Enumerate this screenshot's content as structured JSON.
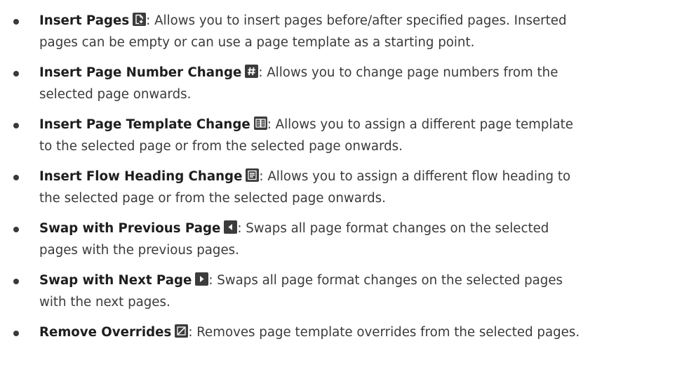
{
  "items": [
    {
      "name": "Insert Pages",
      "icon": "insert-pages-icon",
      "line1": ": Allows you to insert pages before/after specified pages. Inserted",
      "line2": "pages can be empty or can use a page template as a starting point."
    },
    {
      "name": "Insert Page Number Change",
      "icon": "page-number-hash-icon",
      "line1": ": Allows you to change page numbers from the",
      "line2": "selected page onwards."
    },
    {
      "name": "Insert Page Template Change",
      "icon": "page-template-icon",
      "line1": ": Allows you to assign a different page template",
      "line2": "to the selected page or from the selected page onwards."
    },
    {
      "name": "Insert Flow Heading Change",
      "icon": "flow-heading-icon",
      "line1": ": Allows you to assign a different flow heading to",
      "line2": "the selected page or from the selected page onwards."
    },
    {
      "name": "Swap with Previous Page",
      "icon": "previous-arrow-icon",
      "line1": ": Swaps all page format changes on the selected",
      "line2": "pages with the previous pages."
    },
    {
      "name": "Swap with Next Page",
      "icon": "next-arrow-icon",
      "line1": ": Swaps all page format changes on the selected pages",
      "line2": "with the next pages."
    },
    {
      "name": "Remove Overrides",
      "icon": "remove-overrides-icon",
      "line1": ": Removes page template overrides from the selected pages.",
      "line2": ""
    }
  ],
  "colors": {
    "text": "#3a3a3a",
    "heading": "#1e1e1e",
    "icon_bg": "#3c3c3c",
    "icon_fg": "#ffffff"
  }
}
